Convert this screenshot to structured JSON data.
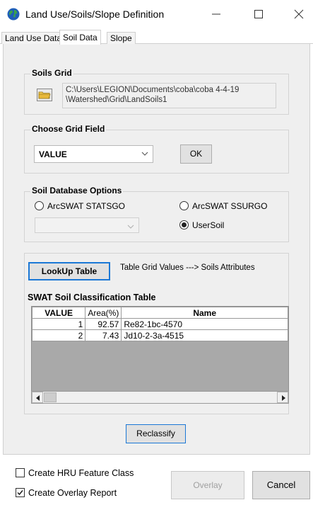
{
  "window": {
    "title": "Land Use/Soils/Slope Definition",
    "app_icon": "globe-icon",
    "controls": [
      "minimize-icon",
      "maximize-icon",
      "close-icon"
    ]
  },
  "tabs": [
    {
      "label": "Land Use Data",
      "active": false
    },
    {
      "label": "Soil Data",
      "active": true
    },
    {
      "label": "Slope",
      "active": false
    }
  ],
  "soils_grid": {
    "title": "Soils Grid",
    "path_line1": "C:\\Users\\LEGION\\Documents\\coba\\coba 4-4-19",
    "path_line2": "\\Watershed\\Grid\\LandSoils1"
  },
  "grid_field": {
    "title": "Choose Grid Field",
    "selected": "VALUE",
    "ok_label": "OK"
  },
  "soil_db": {
    "title": "Soil Database Options",
    "option_statsgo": "ArcSWAT STATSGO",
    "option_ssurgo": "ArcSWAT SSURGO",
    "option_usersoil": "UserSoil",
    "selected": "UserSoil"
  },
  "lookup": {
    "button_label": "LookUp Table",
    "description": "Table Grid Values ---> Soils Attributes"
  },
  "classification": {
    "title": "SWAT Soil Classification Table",
    "columns": [
      "VALUE",
      "Area(%)",
      "Name"
    ],
    "rows": [
      {
        "value": "1",
        "area": "92.57",
        "name": "Re82-1bc-4570"
      },
      {
        "value": "2",
        "area": "7.43",
        "name": "Jd10-2-3a-4515"
      }
    ]
  },
  "reclassify_label": "Reclassify",
  "footer": {
    "create_hru_label": "Create HRU Feature Class",
    "create_hru_checked": false,
    "create_overlay_label": "Create Overlay Report",
    "create_overlay_checked": true,
    "overlay_label": "Overlay",
    "cancel_label": "Cancel"
  },
  "colors": {
    "accent": "#1b78d6",
    "grid_background": "#a9a9a9",
    "panel_background": "#efefef"
  }
}
